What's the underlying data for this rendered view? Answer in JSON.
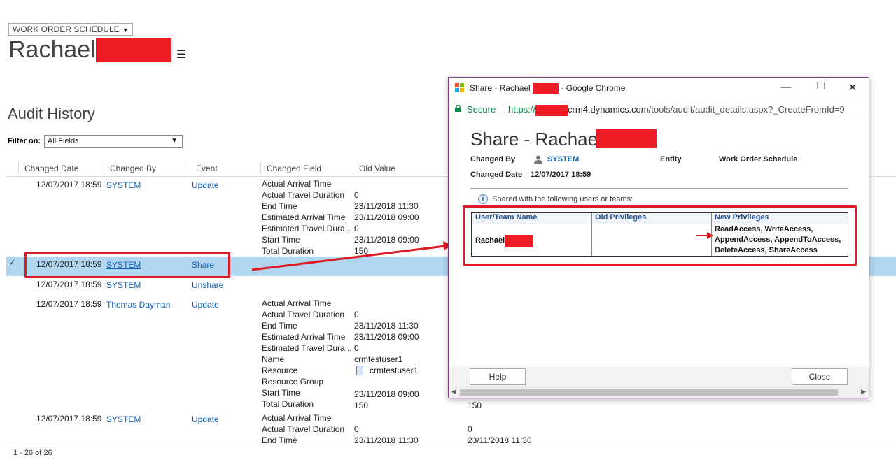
{
  "header": {
    "entity_type": "WORK ORDER SCHEDULE",
    "record_name": "Rachael"
  },
  "audit": {
    "title": "Audit History",
    "filter_label": "Filter on:",
    "filter_value": "All Fields",
    "columns": [
      "Changed Date",
      "Changed By",
      "Event",
      "Changed Field",
      "Old Value"
    ],
    "rows": [
      {
        "date": "12/07/2017 18:59",
        "by": "SYSTEM",
        "event": "Update",
        "fields": [
          "Actual Arrival Time",
          "Actual Travel Duration",
          "End Time",
          "Estimated Arrival Time",
          "Estimated Travel Dura...",
          "Start Time",
          "Total Duration"
        ],
        "old": [
          "",
          "0",
          "23/11/2018 11:30",
          "23/11/2018 09:00",
          "0",
          "23/11/2018 09:00",
          "150"
        ]
      },
      {
        "date": "12/07/2017 18:59",
        "by": "SYSTEM",
        "event": "Share"
      },
      {
        "date": "12/07/2017 18:59",
        "by": "SYSTEM",
        "event": "Unshare"
      },
      {
        "date": "12/07/2017 18:59",
        "by": "Thomas Dayman",
        "event": "Update",
        "fields": [
          "Actual Arrival Time",
          "Actual Travel Duration",
          "End Time",
          "Estimated Arrival Time",
          "Estimated Travel Dura...",
          "Name",
          "Resource",
          "Resource Group",
          "Start Time",
          "Total Duration"
        ],
        "old": [
          "",
          "0",
          "23/11/2018 11:30",
          "23/11/2018 09:00",
          "0",
          "crmtestuser1",
          "crmtestuser1",
          "",
          "23/11/2018 09:00",
          "150"
        ],
        "new_total_duration": "150"
      },
      {
        "date": "12/07/2017 18:59",
        "by": "SYSTEM",
        "event": "Update",
        "fields": [
          "Actual Arrival Time",
          "Actual Travel Duration",
          "End Time"
        ],
        "old": [
          "",
          "0",
          "23/11/2018 11:30"
        ],
        "new": [
          "",
          "0",
          "23/11/2018 11:30"
        ]
      }
    ],
    "footer_count": "1 - 26 of 26"
  },
  "popup": {
    "window_title_prefix": "Share - Rachael",
    "window_title_suffix": "- Google Chrome",
    "secure_label": "Secure",
    "url_scheme": "https://",
    "url_host": "crm4.dynamics.com",
    "url_path": "/tools/audit/audit_details.aspx?_CreateFromId=9",
    "heading": "Share - Rachael",
    "changed_by_label": "Changed By",
    "changed_by_value": "SYSTEM",
    "entity_label": "Entity",
    "entity_value": "Work Order Schedule",
    "changed_date_label": "Changed Date",
    "changed_date_value": "12/07/2017 18:59",
    "shared_info": "Shared with the following users or teams:",
    "table_headers": [
      "User/Team Name",
      "Old Privileges",
      "New Privileges"
    ],
    "user_name": "Rachael",
    "new_privileges": [
      "ReadAccess, WriteAccess,",
      "AppendAccess, AppendToAccess,",
      "DeleteAccess, ShareAccess"
    ],
    "help_label": "Help",
    "close_label": "Close"
  },
  "colors": {
    "link": "#1160b7",
    "selected_row": "#b1d6f0",
    "annotation_red": "#e01a22",
    "secure_green": "#0b8043"
  }
}
